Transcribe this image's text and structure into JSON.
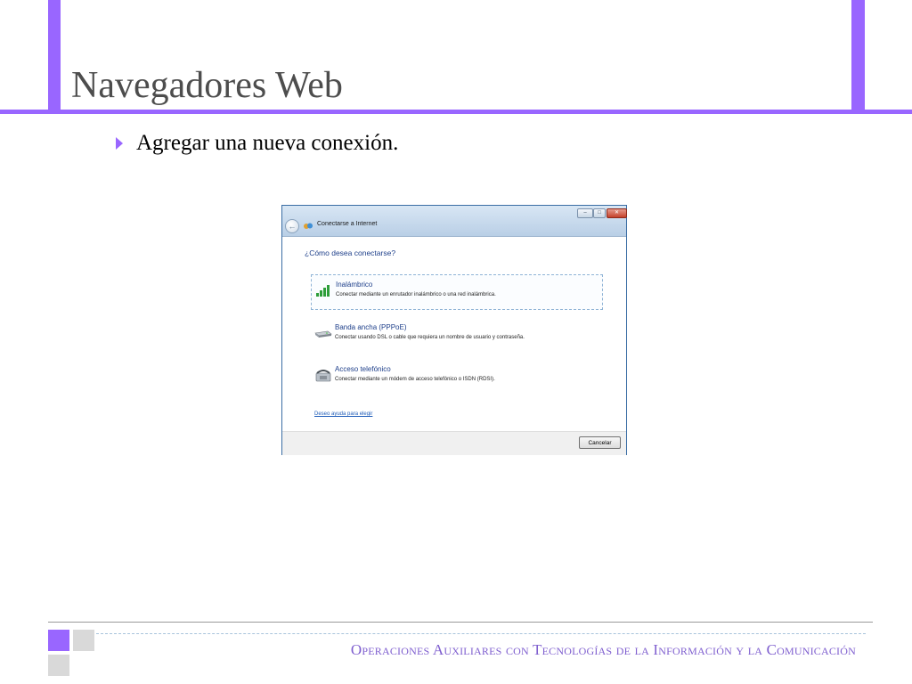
{
  "slide": {
    "title": "Navegadores Web",
    "bullet": "Agregar una nueva conexión.",
    "footer": "Operaciones Auxiliares con Tecnologías de la Información y la Comunicación"
  },
  "dialog": {
    "title": "Conectarse a Internet",
    "heading": "¿Cómo desea conectarse?",
    "options": [
      {
        "title": "Inalámbrico",
        "description": "Conectar mediante un enrutador inalámbrico o una red inalámbrica.",
        "icon": "wireless-signal-icon"
      },
      {
        "title": "Banda ancha (PPPoE)",
        "description": "Conectar usando DSL o cable que requiera un nombre de usuario y contraseña.",
        "icon": "broadband-modem-icon"
      },
      {
        "title": "Acceso telefónico",
        "description": "Conectar mediante un módem de acceso telefónico o ISDN (RDSI).",
        "icon": "dialup-phone-icon"
      }
    ],
    "help_link": "Deseo ayuda para elegir",
    "cancel_label": "Cancelar"
  },
  "colors": {
    "accent": "#9966ff",
    "title_text": "#4d4d4d",
    "dialog_link": "#1e3f8a"
  }
}
